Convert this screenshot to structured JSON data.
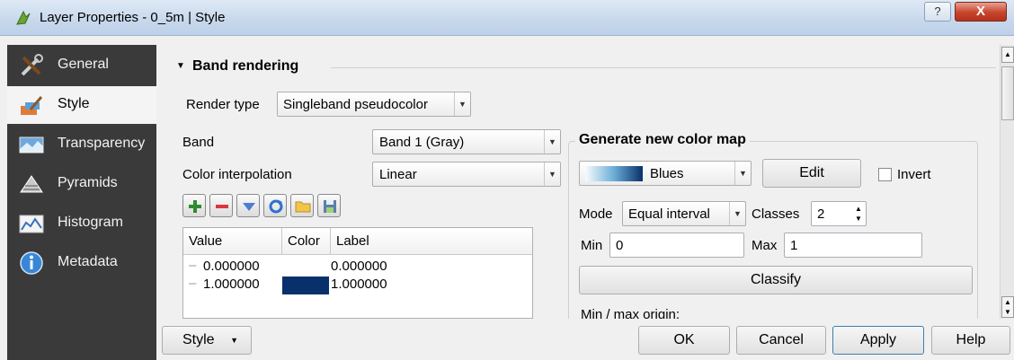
{
  "window": {
    "title": "Layer Properties - 0_5m | Style",
    "help_glyph": "?",
    "close_glyph": "X"
  },
  "sidebar": {
    "items": [
      {
        "label": "General",
        "icon": "tools-icon"
      },
      {
        "label": "Style",
        "icon": "paintbrush-icon"
      },
      {
        "label": "Transparency",
        "icon": "transparency-icon"
      },
      {
        "label": "Pyramids",
        "icon": "pyramids-icon"
      },
      {
        "label": "Histogram",
        "icon": "histogram-icon"
      },
      {
        "label": "Metadata",
        "icon": "info-icon"
      }
    ]
  },
  "band_rendering": {
    "heading": "Band rendering",
    "render_type_label": "Render type",
    "render_type_value": "Singleband pseudocolor",
    "band_label": "Band",
    "band_value": "Band 1 (Gray)",
    "interp_label": "Color interpolation",
    "interp_value": "Linear",
    "table": {
      "headers": [
        "Value",
        "Color",
        "Label"
      ],
      "rows": [
        {
          "value": "0.000000",
          "color": "#ffffff",
          "label": "0.000000"
        },
        {
          "value": "1.000000",
          "color": "#08306b",
          "label": "1.000000"
        }
      ]
    }
  },
  "color_map": {
    "title": "Generate new color map",
    "ramp": "Blues",
    "edit_label": "Edit",
    "invert_label": "Invert",
    "mode_label": "Mode",
    "mode_value": "Equal interval",
    "classes_label": "Classes",
    "classes_value": "2",
    "min_label": "Min",
    "min_value": "0",
    "max_label": "Max",
    "max_value": "1",
    "classify_label": "Classify",
    "minmax_label": "Min / max origin:"
  },
  "footer": {
    "style_label": "Style",
    "ok_label": "OK",
    "cancel_label": "Cancel",
    "apply_label": "Apply",
    "help_label": "Help"
  }
}
